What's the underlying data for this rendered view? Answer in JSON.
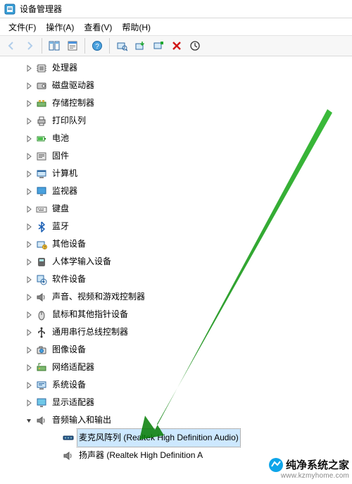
{
  "window": {
    "title": "设备管理器"
  },
  "menubar": {
    "items": [
      {
        "label": "文件(F)"
      },
      {
        "label": "操作(A)"
      },
      {
        "label": "查看(V)"
      },
      {
        "label": "帮助(H)"
      }
    ]
  },
  "tree": {
    "items": [
      {
        "label": "处理器",
        "icon": "cpu"
      },
      {
        "label": "磁盘驱动器",
        "icon": "disk"
      },
      {
        "label": "存储控制器",
        "icon": "storage"
      },
      {
        "label": "打印队列",
        "icon": "printer"
      },
      {
        "label": "电池",
        "icon": "battery"
      },
      {
        "label": "固件",
        "icon": "firmware"
      },
      {
        "label": "计算机",
        "icon": "computer"
      },
      {
        "label": "监视器",
        "icon": "monitor"
      },
      {
        "label": "键盘",
        "icon": "keyboard"
      },
      {
        "label": "蓝牙",
        "icon": "bluetooth"
      },
      {
        "label": "其他设备",
        "icon": "other"
      },
      {
        "label": "人体学输入设备",
        "icon": "hid"
      },
      {
        "label": "软件设备",
        "icon": "software"
      },
      {
        "label": "声音、视频和游戏控制器",
        "icon": "sound"
      },
      {
        "label": "鼠标和其他指针设备",
        "icon": "mouse"
      },
      {
        "label": "通用串行总线控制器",
        "icon": "usb"
      },
      {
        "label": "图像设备",
        "icon": "camera"
      },
      {
        "label": "网络适配器",
        "icon": "network"
      },
      {
        "label": "系统设备",
        "icon": "system"
      },
      {
        "label": "显示适配器",
        "icon": "display"
      }
    ],
    "expandedCategory": {
      "label": "音频输入和输出",
      "icon": "sound"
    },
    "expandedChildren": [
      {
        "label": "麦克风阵列 (Realtek High Definition Audio)",
        "icon": "micdev",
        "selected": true
      },
      {
        "label": "扬声器 (Realtek High Definition A",
        "icon": "sound",
        "selected": false
      }
    ]
  },
  "watermark": {
    "name": "纯净系统之家",
    "url": "www.kzmyhome.com"
  }
}
